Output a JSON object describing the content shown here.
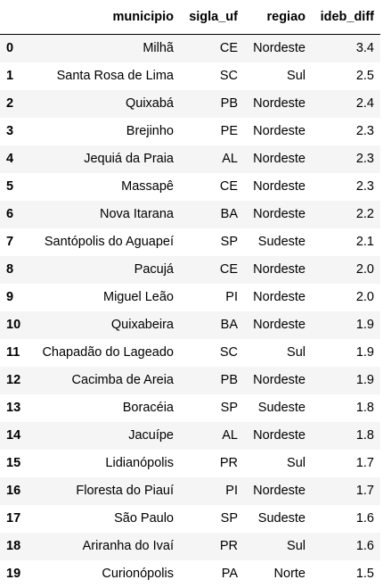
{
  "table": {
    "columns": [
      "municipio",
      "sigla_uf",
      "regiao",
      "ideb_diff"
    ],
    "rows": [
      {
        "index": "0",
        "municipio": "Milhã",
        "sigla_uf": "CE",
        "regiao": "Nordeste",
        "ideb_diff": "3.4"
      },
      {
        "index": "1",
        "municipio": "Santa Rosa de Lima",
        "sigla_uf": "SC",
        "regiao": "Sul",
        "ideb_diff": "2.5"
      },
      {
        "index": "2",
        "municipio": "Quixabá",
        "sigla_uf": "PB",
        "regiao": "Nordeste",
        "ideb_diff": "2.4"
      },
      {
        "index": "3",
        "municipio": "Brejinho",
        "sigla_uf": "PE",
        "regiao": "Nordeste",
        "ideb_diff": "2.3"
      },
      {
        "index": "4",
        "municipio": "Jequiá da Praia",
        "sigla_uf": "AL",
        "regiao": "Nordeste",
        "ideb_diff": "2.3"
      },
      {
        "index": "5",
        "municipio": "Massapê",
        "sigla_uf": "CE",
        "regiao": "Nordeste",
        "ideb_diff": "2.3"
      },
      {
        "index": "6",
        "municipio": "Nova Itarana",
        "sigla_uf": "BA",
        "regiao": "Nordeste",
        "ideb_diff": "2.2"
      },
      {
        "index": "7",
        "municipio": "Santópolis do Aguapeí",
        "sigla_uf": "SP",
        "regiao": "Sudeste",
        "ideb_diff": "2.1"
      },
      {
        "index": "8",
        "municipio": "Pacujá",
        "sigla_uf": "CE",
        "regiao": "Nordeste",
        "ideb_diff": "2.0"
      },
      {
        "index": "9",
        "municipio": "Miguel Leão",
        "sigla_uf": "PI",
        "regiao": "Nordeste",
        "ideb_diff": "2.0"
      },
      {
        "index": "10",
        "municipio": "Quixabeira",
        "sigla_uf": "BA",
        "regiao": "Nordeste",
        "ideb_diff": "1.9"
      },
      {
        "index": "11",
        "municipio": "Chapadão do Lageado",
        "sigla_uf": "SC",
        "regiao": "Sul",
        "ideb_diff": "1.9"
      },
      {
        "index": "12",
        "municipio": "Cacimba de Areia",
        "sigla_uf": "PB",
        "regiao": "Nordeste",
        "ideb_diff": "1.9"
      },
      {
        "index": "13",
        "municipio": "Boracéia",
        "sigla_uf": "SP",
        "regiao": "Sudeste",
        "ideb_diff": "1.8"
      },
      {
        "index": "14",
        "municipio": "Jacuípe",
        "sigla_uf": "AL",
        "regiao": "Nordeste",
        "ideb_diff": "1.8"
      },
      {
        "index": "15",
        "municipio": "Lidianópolis",
        "sigla_uf": "PR",
        "regiao": "Sul",
        "ideb_diff": "1.7"
      },
      {
        "index": "16",
        "municipio": "Floresta do Piauí",
        "sigla_uf": "PI",
        "regiao": "Nordeste",
        "ideb_diff": "1.7"
      },
      {
        "index": "17",
        "municipio": "São Paulo",
        "sigla_uf": "SP",
        "regiao": "Sudeste",
        "ideb_diff": "1.6"
      },
      {
        "index": "18",
        "municipio": "Ariranha do Ivaí",
        "sigla_uf": "PR",
        "regiao": "Sul",
        "ideb_diff": "1.6"
      },
      {
        "index": "19",
        "municipio": "Curionópolis",
        "sigla_uf": "PA",
        "regiao": "Norte",
        "ideb_diff": "1.5"
      }
    ]
  }
}
